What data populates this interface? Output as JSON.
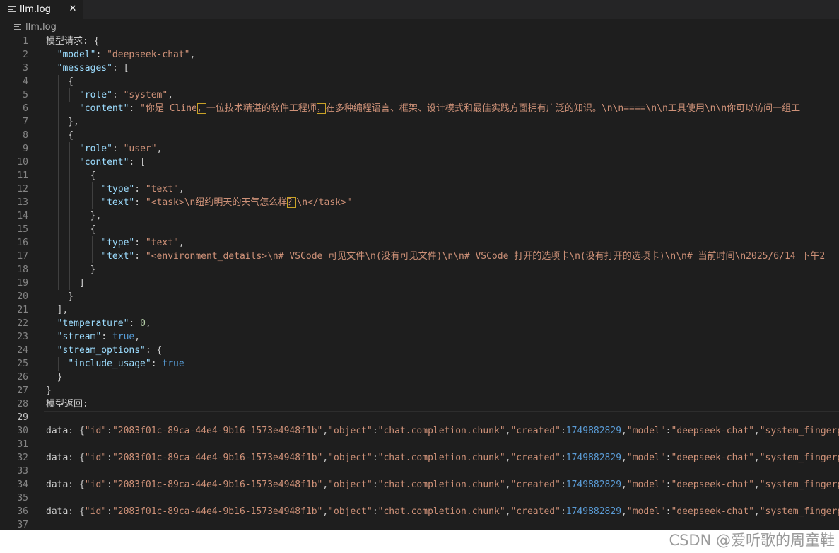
{
  "tab": {
    "title": "llm.log",
    "close_glyph": "✕",
    "icon": "file-lines-icon"
  },
  "breadcrumb": {
    "file": "llm.log",
    "icon": "file-lines-icon"
  },
  "editor": {
    "active_line": 29,
    "lines": [
      {
        "no": "1",
        "tokens": [
          [
            "p",
            "模型请求: {"
          ]
        ]
      },
      {
        "no": "2",
        "tokens": [
          [
            "p",
            "  "
          ],
          [
            "k",
            "\"model\""
          ],
          [
            "p",
            ": "
          ],
          [
            "s",
            "\"deepseek-chat\""
          ],
          [
            "p",
            ","
          ]
        ]
      },
      {
        "no": "3",
        "tokens": [
          [
            "p",
            "  "
          ],
          [
            "k",
            "\"messages\""
          ],
          [
            "p",
            ": ["
          ]
        ]
      },
      {
        "no": "4",
        "tokens": [
          [
            "p",
            "    {"
          ]
        ]
      },
      {
        "no": "5",
        "tokens": [
          [
            "p",
            "      "
          ],
          [
            "k",
            "\"role\""
          ],
          [
            "p",
            ": "
          ],
          [
            "s",
            "\"system\""
          ],
          [
            "p",
            ","
          ]
        ]
      },
      {
        "no": "6",
        "tokens": [
          [
            "p",
            "      "
          ],
          [
            "k",
            "\"content\""
          ],
          [
            "p",
            ": "
          ],
          [
            "s",
            "\"你是 Cline"
          ],
          [
            "sh",
            "，"
          ],
          [
            "s",
            "一位技术精湛的软件工程师"
          ],
          [
            "sh",
            "，"
          ],
          [
            "s",
            "在多种编程语言、框架、设计模式和最佳实践方面拥有广泛的知识。\\n\\n====\\n\\n工具使用\\n\\n你可以访问一组工"
          ]
        ]
      },
      {
        "no": "7",
        "tokens": [
          [
            "p",
            "    },"
          ]
        ]
      },
      {
        "no": "8",
        "tokens": [
          [
            "p",
            "    {"
          ]
        ]
      },
      {
        "no": "9",
        "tokens": [
          [
            "p",
            "      "
          ],
          [
            "k",
            "\"role\""
          ],
          [
            "p",
            ": "
          ],
          [
            "s",
            "\"user\""
          ],
          [
            "p",
            ","
          ]
        ]
      },
      {
        "no": "10",
        "tokens": [
          [
            "p",
            "      "
          ],
          [
            "k",
            "\"content\""
          ],
          [
            "p",
            ": ["
          ]
        ]
      },
      {
        "no": "11",
        "tokens": [
          [
            "p",
            "        {"
          ]
        ]
      },
      {
        "no": "12",
        "tokens": [
          [
            "p",
            "          "
          ],
          [
            "k",
            "\"type\""
          ],
          [
            "p",
            ": "
          ],
          [
            "s",
            "\"text\""
          ],
          [
            "p",
            ","
          ]
        ]
      },
      {
        "no": "13",
        "tokens": [
          [
            "p",
            "          "
          ],
          [
            "k",
            "\"text\""
          ],
          [
            "p",
            ": "
          ],
          [
            "s",
            "\"<task>\\n纽约明天的天气怎么样"
          ],
          [
            "sh",
            "？"
          ],
          [
            "s",
            "\\n</task>\""
          ]
        ]
      },
      {
        "no": "14",
        "tokens": [
          [
            "p",
            "        },"
          ]
        ]
      },
      {
        "no": "15",
        "tokens": [
          [
            "p",
            "        {"
          ]
        ]
      },
      {
        "no": "16",
        "tokens": [
          [
            "p",
            "          "
          ],
          [
            "k",
            "\"type\""
          ],
          [
            "p",
            ": "
          ],
          [
            "s",
            "\"text\""
          ],
          [
            "p",
            ","
          ]
        ]
      },
      {
        "no": "17",
        "tokens": [
          [
            "p",
            "          "
          ],
          [
            "k",
            "\"text\""
          ],
          [
            "p",
            ": "
          ],
          [
            "s",
            "\"<environment_details>\\n# VSCode 可见文件\\n(没有可见文件)\\n\\n# VSCode 打开的选项卡\\n(没有打开的选项卡)\\n\\n# 当前时间\\n2025/6/14 下午2"
          ]
        ]
      },
      {
        "no": "18",
        "tokens": [
          [
            "p",
            "        }"
          ]
        ]
      },
      {
        "no": "19",
        "tokens": [
          [
            "p",
            "      ]"
          ]
        ]
      },
      {
        "no": "20",
        "tokens": [
          [
            "p",
            "    }"
          ]
        ]
      },
      {
        "no": "21",
        "tokens": [
          [
            "p",
            "  ],"
          ]
        ]
      },
      {
        "no": "22",
        "tokens": [
          [
            "p",
            "  "
          ],
          [
            "k",
            "\"temperature\""
          ],
          [
            "p",
            ": "
          ],
          [
            "n",
            "0"
          ],
          [
            "p",
            ","
          ]
        ]
      },
      {
        "no": "23",
        "tokens": [
          [
            "p",
            "  "
          ],
          [
            "k",
            "\"stream\""
          ],
          [
            "p",
            ": "
          ],
          [
            "b",
            "true"
          ],
          [
            "p",
            ","
          ]
        ]
      },
      {
        "no": "24",
        "tokens": [
          [
            "p",
            "  "
          ],
          [
            "k",
            "\"stream_options\""
          ],
          [
            "p",
            ": {"
          ]
        ]
      },
      {
        "no": "25",
        "tokens": [
          [
            "p",
            "    "
          ],
          [
            "k",
            "\"include_usage\""
          ],
          [
            "p",
            ": "
          ],
          [
            "b",
            "true"
          ]
        ]
      },
      {
        "no": "26",
        "tokens": [
          [
            "p",
            "  }"
          ]
        ]
      },
      {
        "no": "27",
        "tokens": [
          [
            "p",
            "}"
          ]
        ]
      },
      {
        "no": "28",
        "tokens": [
          [
            "p",
            "模型返回:"
          ]
        ]
      },
      {
        "no": "29",
        "tokens": []
      },
      {
        "no": "30",
        "tokens": [
          [
            "p",
            "data: {"
          ],
          [
            "s",
            "\"id\""
          ],
          [
            "p",
            ":"
          ],
          [
            "s",
            "\"2083f01c-89ca-44e4-9b16-1573e4948f1b\""
          ],
          [
            "p",
            ","
          ],
          [
            "s",
            "\"object\""
          ],
          [
            "p",
            ":"
          ],
          [
            "s",
            "\"chat.completion.chunk\""
          ],
          [
            "p",
            ","
          ],
          [
            "s",
            "\"created\""
          ],
          [
            "p",
            ":"
          ],
          [
            "nb",
            "1749882829"
          ],
          [
            "p",
            ","
          ],
          [
            "s",
            "\"model\""
          ],
          [
            "p",
            ":"
          ],
          [
            "s",
            "\"deepseek-chat\""
          ],
          [
            "p",
            ","
          ],
          [
            "s",
            "\"system_fingerpr"
          ]
        ]
      },
      {
        "no": "31",
        "tokens": []
      },
      {
        "no": "32",
        "tokens": [
          [
            "p",
            "data: {"
          ],
          [
            "s",
            "\"id\""
          ],
          [
            "p",
            ":"
          ],
          [
            "s",
            "\"2083f01c-89ca-44e4-9b16-1573e4948f1b\""
          ],
          [
            "p",
            ","
          ],
          [
            "s",
            "\"object\""
          ],
          [
            "p",
            ":"
          ],
          [
            "s",
            "\"chat.completion.chunk\""
          ],
          [
            "p",
            ","
          ],
          [
            "s",
            "\"created\""
          ],
          [
            "p",
            ":"
          ],
          [
            "nb",
            "1749882829"
          ],
          [
            "p",
            ","
          ],
          [
            "s",
            "\"model\""
          ],
          [
            "p",
            ":"
          ],
          [
            "s",
            "\"deepseek-chat\""
          ],
          [
            "p",
            ","
          ],
          [
            "s",
            "\"system_fingerpr"
          ]
        ]
      },
      {
        "no": "33",
        "tokens": []
      },
      {
        "no": "34",
        "tokens": [
          [
            "p",
            "data: {"
          ],
          [
            "s",
            "\"id\""
          ],
          [
            "p",
            ":"
          ],
          [
            "s",
            "\"2083f01c-89ca-44e4-9b16-1573e4948f1b\""
          ],
          [
            "p",
            ","
          ],
          [
            "s",
            "\"object\""
          ],
          [
            "p",
            ":"
          ],
          [
            "s",
            "\"chat.completion.chunk\""
          ],
          [
            "p",
            ","
          ],
          [
            "s",
            "\"created\""
          ],
          [
            "p",
            ":"
          ],
          [
            "nb",
            "1749882829"
          ],
          [
            "p",
            ","
          ],
          [
            "s",
            "\"model\""
          ],
          [
            "p",
            ":"
          ],
          [
            "s",
            "\"deepseek-chat\""
          ],
          [
            "p",
            ","
          ],
          [
            "s",
            "\"system_fingerpr"
          ]
        ]
      },
      {
        "no": "35",
        "tokens": []
      },
      {
        "no": "36",
        "tokens": [
          [
            "p",
            "data: {"
          ],
          [
            "s",
            "\"id\""
          ],
          [
            "p",
            ":"
          ],
          [
            "s",
            "\"2083f01c-89ca-44e4-9b16-1573e4948f1b\""
          ],
          [
            "p",
            ","
          ],
          [
            "s",
            "\"object\""
          ],
          [
            "p",
            ":"
          ],
          [
            "s",
            "\"chat.completion.chunk\""
          ],
          [
            "p",
            ","
          ],
          [
            "s",
            "\"created\""
          ],
          [
            "p",
            ":"
          ],
          [
            "nb",
            "1749882829"
          ],
          [
            "p",
            ","
          ],
          [
            "s",
            "\"model\""
          ],
          [
            "p",
            ":"
          ],
          [
            "s",
            "\"deepseek-chat\""
          ],
          [
            "p",
            ","
          ],
          [
            "s",
            "\"system_fingerpr"
          ]
        ]
      },
      {
        "no": "37",
        "tokens": []
      }
    ]
  },
  "watermark": {
    "text": "CSDN @爱听歌的周童鞋"
  }
}
